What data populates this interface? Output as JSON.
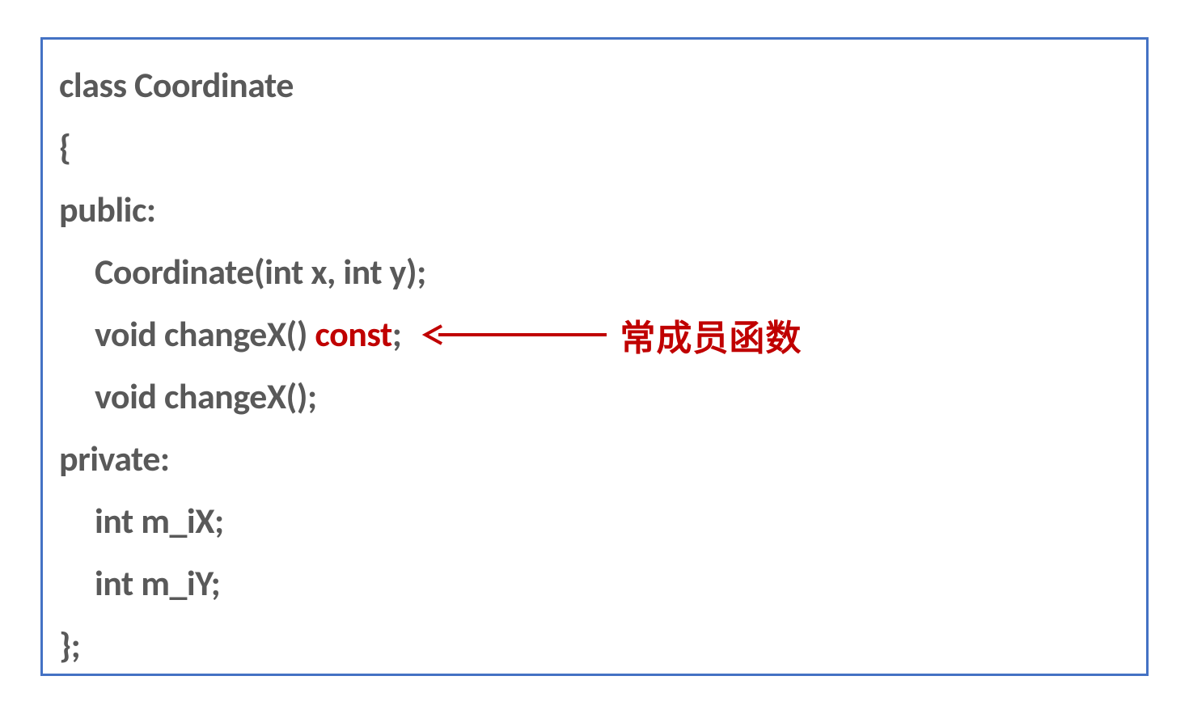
{
  "code": {
    "line1": "class Coordinate",
    "line2": "{",
    "line3": "public:",
    "line4": "Coordinate(int x, int y);",
    "line5_prefix": "void changeX() ",
    "line5_const": "const",
    "line5_suffix": ";",
    "line6": "void changeX();",
    "line7": "private:",
    "line8": "int m_iX;",
    "line9": "int m_iY;",
    "line10": "};"
  },
  "annotation": {
    "label": "常成员函数"
  },
  "colors": {
    "border": "#4472c4",
    "text_gray": "#595959",
    "highlight_red": "#c00000"
  }
}
